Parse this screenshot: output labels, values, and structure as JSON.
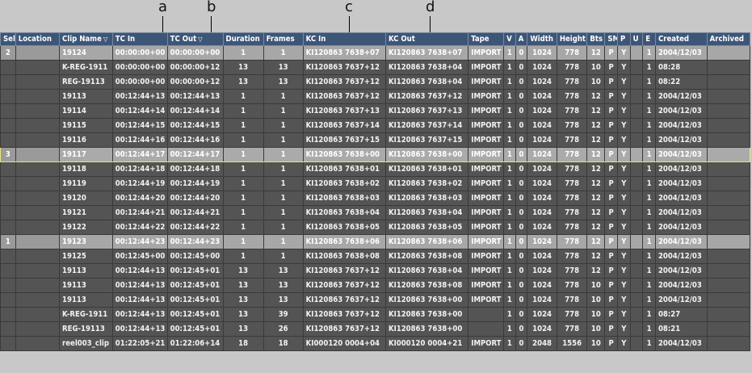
{
  "callouts": [
    "a",
    "b",
    "c",
    "d"
  ],
  "columns": [
    {
      "label": "Sel"
    },
    {
      "label": "Location"
    },
    {
      "label": "Clip Name",
      "sort": "▽"
    },
    {
      "label": "TC In"
    },
    {
      "label": "TC Out",
      "sort": "▽"
    },
    {
      "label": "Duration"
    },
    {
      "label": "Frames"
    },
    {
      "label": "KC In"
    },
    {
      "label": "KC Out"
    },
    {
      "label": "Tape"
    },
    {
      "label": "V"
    },
    {
      "label": "A"
    },
    {
      "label": "Width"
    },
    {
      "label": "Height"
    },
    {
      "label": "Bts"
    },
    {
      "label": "SM"
    },
    {
      "label": "P"
    },
    {
      "label": "U"
    },
    {
      "label": "E"
    },
    {
      "label": "Created"
    },
    {
      "label": "Archived"
    }
  ],
  "rows": [
    {
      "state": "sel",
      "cells": [
        "2",
        "",
        "19124",
        "00:00:00+00",
        "00:00:00+00",
        "1",
        "1",
        "KI120863 7638+07",
        "KI120863 7638+07",
        "IMPORT",
        "1",
        "0",
        "1024",
        "778",
        "12",
        "P",
        "Y",
        "",
        "1",
        "2004/12/03",
        ""
      ]
    },
    {
      "state": "",
      "cells": [
        "",
        "",
        "K-REG-1911",
        "00:00:00+00",
        "00:00:00+12",
        "13",
        "13",
        "KI120863 7637+12",
        "KI120863 7638+04",
        "IMPORT",
        "1",
        "0",
        "1024",
        "778",
        "10",
        "P",
        "Y",
        "",
        "1",
        "08:28",
        ""
      ]
    },
    {
      "state": "",
      "cells": [
        "",
        "",
        "REG-19113",
        "00:00:00+00",
        "00:00:00+12",
        "13",
        "13",
        "KI120863 7637+12",
        "KI120863 7638+04",
        "IMPORT",
        "1",
        "0",
        "1024",
        "778",
        "10",
        "P",
        "Y",
        "",
        "1",
        "08:22",
        ""
      ]
    },
    {
      "state": "",
      "cells": [
        "",
        "",
        "19113",
        "00:12:44+13",
        "00:12:44+13",
        "1",
        "1",
        "KI120863 7637+12",
        "KI120863 7637+12",
        "IMPORT",
        "1",
        "0",
        "1024",
        "778",
        "12",
        "P",
        "Y",
        "",
        "1",
        "2004/12/03",
        ""
      ]
    },
    {
      "state": "",
      "cells": [
        "",
        "",
        "19114",
        "00:12:44+14",
        "00:12:44+14",
        "1",
        "1",
        "KI120863 7637+13",
        "KI120863 7637+13",
        "IMPORT",
        "1",
        "0",
        "1024",
        "778",
        "12",
        "P",
        "Y",
        "",
        "1",
        "2004/12/03",
        ""
      ]
    },
    {
      "state": "",
      "cells": [
        "",
        "",
        "19115",
        "00:12:44+15",
        "00:12:44+15",
        "1",
        "1",
        "KI120863 7637+14",
        "KI120863 7637+14",
        "IMPORT",
        "1",
        "0",
        "1024",
        "778",
        "12",
        "P",
        "Y",
        "",
        "1",
        "2004/12/03",
        ""
      ]
    },
    {
      "state": "",
      "cells": [
        "",
        "",
        "19116",
        "00:12:44+16",
        "00:12:44+16",
        "1",
        "1",
        "KI120863 7637+15",
        "KI120863 7637+15",
        "IMPORT",
        "1",
        "0",
        "1024",
        "778",
        "12",
        "P",
        "Y",
        "",
        "1",
        "2004/12/03",
        ""
      ]
    },
    {
      "state": "hl",
      "cells": [
        "3",
        "",
        "19117",
        "00:12:44+17",
        "00:12:44+17",
        "1",
        "1",
        "KI120863 7638+00",
        "KI120863 7638+00",
        "IMPORT",
        "1",
        "0",
        "1024",
        "778",
        "12",
        "P",
        "Y",
        "",
        "1",
        "2004/12/03",
        ""
      ]
    },
    {
      "state": "",
      "cells": [
        "",
        "",
        "19118",
        "00:12:44+18",
        "00:12:44+18",
        "1",
        "1",
        "KI120863 7638+01",
        "KI120863 7638+01",
        "IMPORT",
        "1",
        "0",
        "1024",
        "778",
        "12",
        "P",
        "Y",
        "",
        "1",
        "2004/12/03",
        ""
      ]
    },
    {
      "state": "",
      "cells": [
        "",
        "",
        "19119",
        "00:12:44+19",
        "00:12:44+19",
        "1",
        "1",
        "KI120863 7638+02",
        "KI120863 7638+02",
        "IMPORT",
        "1",
        "0",
        "1024",
        "778",
        "12",
        "P",
        "Y",
        "",
        "1",
        "2004/12/03",
        ""
      ]
    },
    {
      "state": "",
      "cells": [
        "",
        "",
        "19120",
        "00:12:44+20",
        "00:12:44+20",
        "1",
        "1",
        "KI120863 7638+03",
        "KI120863 7638+03",
        "IMPORT",
        "1",
        "0",
        "1024",
        "778",
        "12",
        "P",
        "Y",
        "",
        "1",
        "2004/12/03",
        ""
      ]
    },
    {
      "state": "",
      "cells": [
        "",
        "",
        "19121",
        "00:12:44+21",
        "00:12:44+21",
        "1",
        "1",
        "KI120863 7638+04",
        "KI120863 7638+04",
        "IMPORT",
        "1",
        "0",
        "1024",
        "778",
        "12",
        "P",
        "Y",
        "",
        "1",
        "2004/12/03",
        ""
      ]
    },
    {
      "state": "",
      "cells": [
        "",
        "",
        "19122",
        "00:12:44+22",
        "00:12:44+22",
        "1",
        "1",
        "KI120863 7638+05",
        "KI120863 7638+05",
        "IMPORT",
        "1",
        "0",
        "1024",
        "778",
        "12",
        "P",
        "Y",
        "",
        "1",
        "2004/12/03",
        ""
      ]
    },
    {
      "state": "sel",
      "cells": [
        "1",
        "",
        "19123",
        "00:12:44+23",
        "00:12:44+23",
        "1",
        "1",
        "KI120863 7638+06",
        "KI120863 7638+06",
        "IMPORT",
        "1",
        "0",
        "1024",
        "778",
        "12",
        "P",
        "Y",
        "",
        "1",
        "2004/12/03",
        ""
      ]
    },
    {
      "state": "",
      "cells": [
        "",
        "",
        "19125",
        "00:12:45+00",
        "00:12:45+00",
        "1",
        "1",
        "KI120863 7638+08",
        "KI120863 7638+08",
        "IMPORT",
        "1",
        "0",
        "1024",
        "778",
        "12",
        "P",
        "Y",
        "",
        "1",
        "2004/12/03",
        ""
      ]
    },
    {
      "state": "",
      "cells": [
        "",
        "",
        "19113",
        "00:12:44+13",
        "00:12:45+01",
        "13",
        "13",
        "KI120863 7637+12",
        "KI120863 7638+04",
        "IMPORT",
        "1",
        "0",
        "1024",
        "778",
        "12",
        "P",
        "Y",
        "",
        "1",
        "2004/12/03",
        ""
      ]
    },
    {
      "state": "",
      "cells": [
        "",
        "",
        "19113",
        "00:12:44+13",
        "00:12:45+01",
        "13",
        "13",
        "KI120863 7637+12",
        "KI120863 7638+08",
        "IMPORT",
        "1",
        "0",
        "1024",
        "778",
        "10",
        "P",
        "Y",
        "",
        "1",
        "2004/12/03",
        ""
      ]
    },
    {
      "state": "",
      "cells": [
        "",
        "",
        "19113",
        "00:12:44+13",
        "00:12:45+01",
        "13",
        "13",
        "KI120863 7637+12",
        "KI120863 7638+00",
        "IMPORT",
        "1",
        "0",
        "1024",
        "778",
        "10",
        "P",
        "Y",
        "",
        "1",
        "2004/12/03",
        ""
      ]
    },
    {
      "state": "",
      "cells": [
        "",
        "",
        "K-REG-1911",
        "00:12:44+13",
        "00:12:45+01",
        "13",
        "39",
        "KI120863 7637+12",
        "KI120863 7638+00",
        "",
        "1",
        "0",
        "1024",
        "778",
        "10",
        "P",
        "Y",
        "",
        "1",
        "08:27",
        ""
      ]
    },
    {
      "state": "",
      "cells": [
        "",
        "",
        "REG-19113",
        "00:12:44+13",
        "00:12:45+01",
        "13",
        "26",
        "KI120863 7637+12",
        "KI120863 7638+00",
        "",
        "1",
        "0",
        "1024",
        "778",
        "10",
        "P",
        "Y",
        "",
        "1",
        "08:21",
        ""
      ]
    },
    {
      "state": "",
      "cells": [
        "",
        "",
        "reel003_clip",
        "01:22:05+21",
        "01:22:06+14",
        "18",
        "18",
        "KI000120 0004+04",
        "KI000120 0004+21",
        "IMPORT",
        "1",
        "0",
        "2048",
        "1556",
        "10",
        "P",
        "Y",
        "",
        "1",
        "2004/12/03",
        ""
      ]
    }
  ]
}
